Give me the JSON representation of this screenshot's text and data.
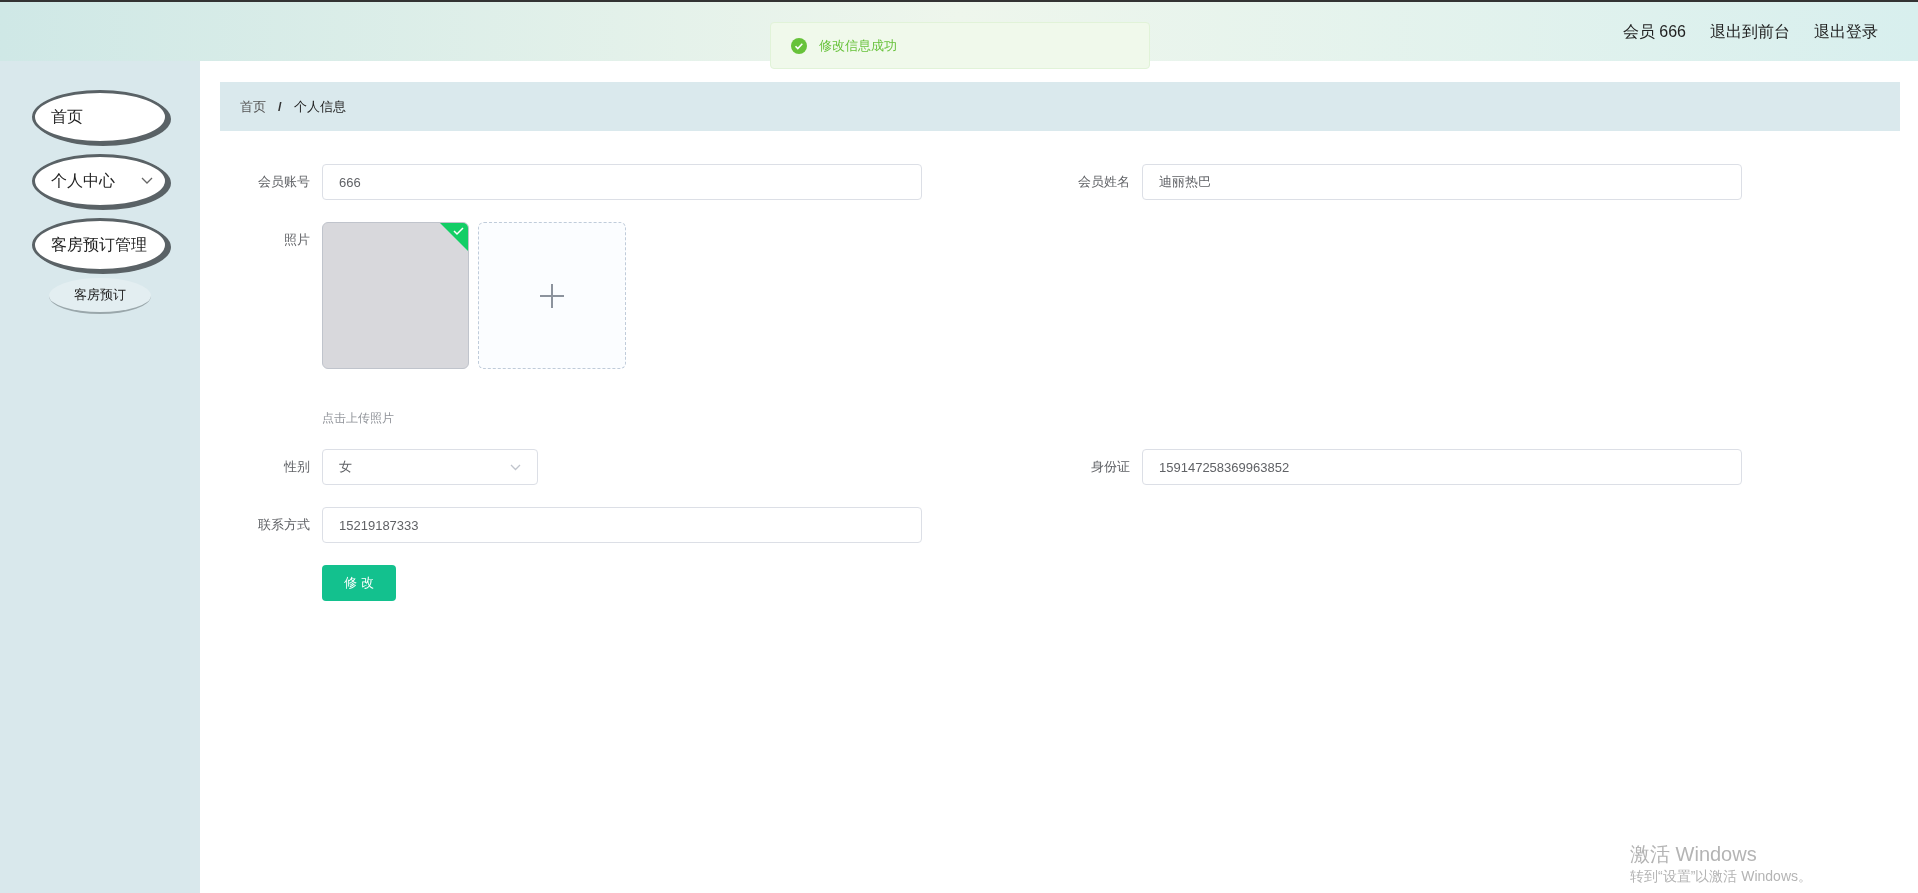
{
  "header": {
    "user_label": "会员 666",
    "links": [
      "退出到前台",
      "退出登录"
    ]
  },
  "toast": {
    "message": "修改信息成功"
  },
  "sidebar": {
    "items": [
      {
        "label": "首页",
        "expandable": false
      },
      {
        "label": "个人中心",
        "expandable": true
      },
      {
        "label": "客房预订管理",
        "expandable": false,
        "children": [
          {
            "label": "客房预订"
          }
        ]
      }
    ]
  },
  "breadcrumb": {
    "items": [
      "首页",
      "个人信息"
    ],
    "separator": "/"
  },
  "form": {
    "account": {
      "label": "会员账号",
      "value": "666"
    },
    "name": {
      "label": "会员姓名",
      "value": "迪丽热巴"
    },
    "photo": {
      "label": "照片",
      "uploaded": true,
      "hint": "点击上传照片"
    },
    "gender": {
      "label": "性别",
      "value": "女"
    },
    "id_card": {
      "label": "身份证",
      "value": "159147258369963852"
    },
    "phone": {
      "label": "联系方式",
      "value": "15219187333"
    },
    "submit": "修 改"
  },
  "activation": {
    "title": "激活 Windows",
    "subtitle": "转到“设置”以激活 Windows。"
  }
}
